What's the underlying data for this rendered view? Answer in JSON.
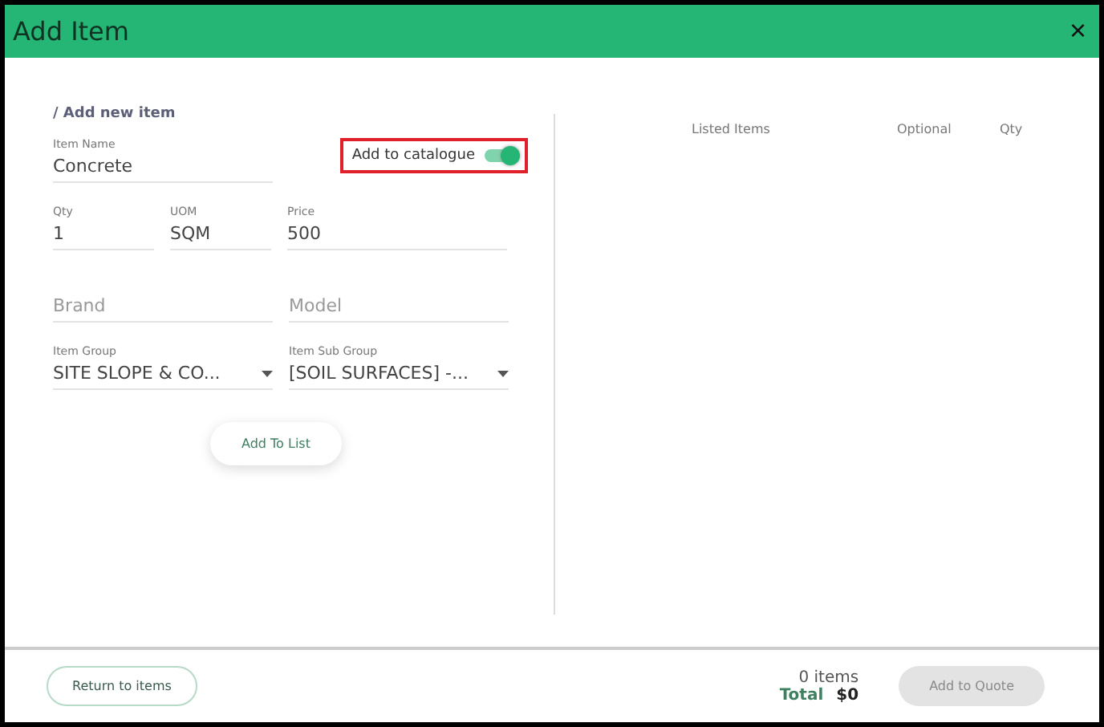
{
  "dialog": {
    "title": "Add Item",
    "close": "×"
  },
  "form": {
    "heading": "/ Add new item",
    "catalogue_toggle": {
      "label": "Add to catalogue",
      "on": true,
      "highlighted": true
    },
    "rows": [
      [
        {
          "kind": "text",
          "label": "Item Name",
          "value": "Concrete"
        }
      ],
      [
        {
          "kind": "text",
          "label": "Qty",
          "value": "1"
        },
        {
          "kind": "text",
          "label": "UOM",
          "value": "SQM"
        },
        {
          "kind": "text",
          "label": "Price",
          "value": "500"
        }
      ],
      [
        {
          "kind": "empty",
          "placeholder": "Brand"
        },
        {
          "kind": "empty",
          "placeholder": "Model"
        }
      ],
      [
        {
          "kind": "select",
          "label": "Item Group",
          "value": "SITE SLOPE & CO..."
        },
        {
          "kind": "select",
          "label": "Item Sub Group",
          "value": "[SOIL SURFACES] -..."
        }
      ]
    ],
    "add_button": "Add To List"
  },
  "list": {
    "columns": [
      "Listed Items",
      "Optional",
      "Qty"
    ]
  },
  "footer": {
    "return_button": "Return to items",
    "count": "0 items",
    "total_label": "Total",
    "total_value": "$0",
    "quote_button": {
      "label": "Add to Quote",
      "disabled": true
    }
  }
}
